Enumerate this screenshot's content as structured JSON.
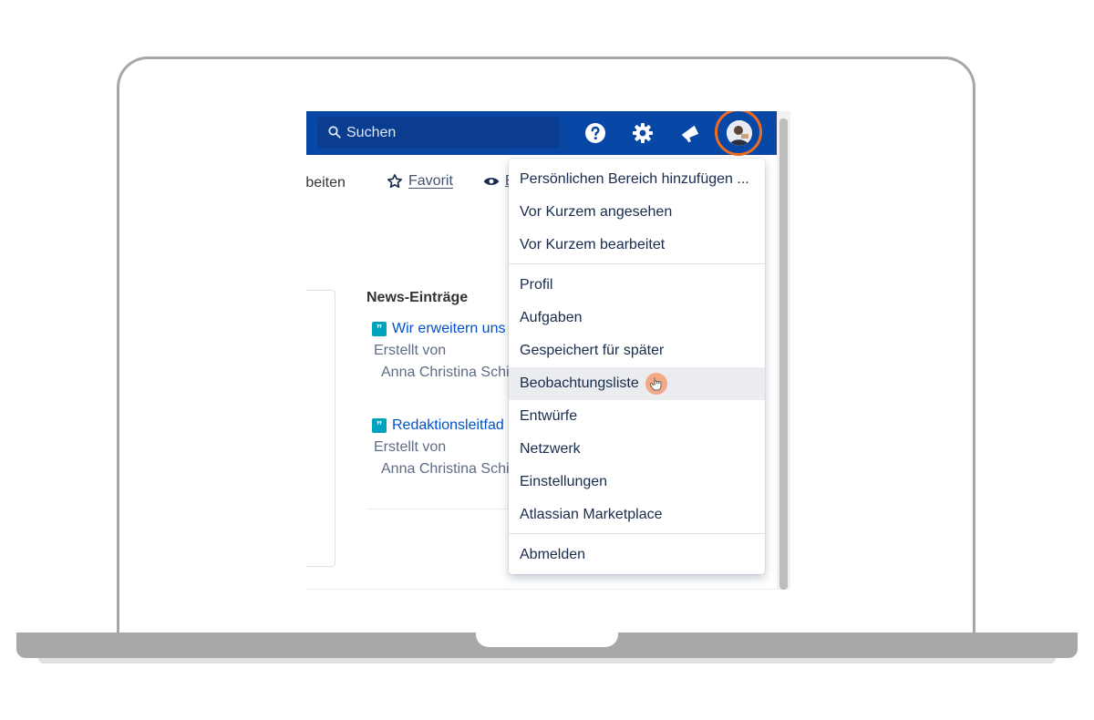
{
  "topbar": {
    "search_placeholder": "Suchen"
  },
  "toolbar": {
    "edit_label": "rbeiten",
    "favorite_label": "Favorit",
    "watch_label": "B"
  },
  "news": {
    "title": "News-Einträge",
    "items": [
      {
        "link": "Wir erweitern uns",
        "meta": "Erstellt von",
        "author": "Anna Christina Schi"
      },
      {
        "link": "Redaktionsleitfad",
        "meta": "Erstellt von",
        "author": "Anna Christina Schi"
      }
    ]
  },
  "menu": {
    "items": [
      "Persönlichen Bereich hinzufügen ...",
      "Vor Kurzem angesehen",
      "Vor Kurzem bearbeitet",
      "Profil",
      "Aufgaben",
      "Gespeichert für später",
      "Beobachtungsliste",
      "Entwürfe",
      "Netzwerk",
      "Einstellungen",
      "Atlassian Marketplace",
      "Abmelden"
    ],
    "hovered_item": "Beobachtungsliste"
  },
  "colors": {
    "topbar": "#0747a6",
    "highlight_ring": "#ef6c1f",
    "link": "#0052cc"
  }
}
